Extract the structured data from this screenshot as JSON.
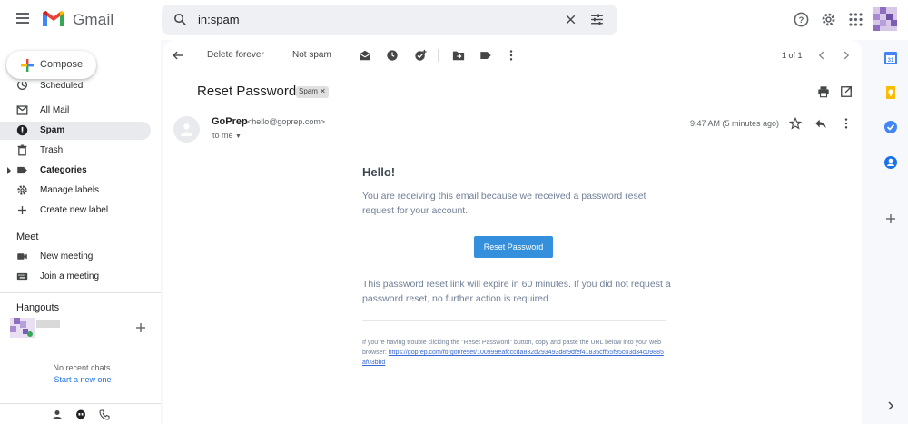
{
  "header": {
    "app_name": "Gmail",
    "search_value": "in:spam",
    "brand_colors": {
      "red": "#ea4335",
      "blue": "#4285f4",
      "green": "#34a853",
      "yellow": "#fbbc04"
    }
  },
  "nav": {
    "compose_label": "Compose",
    "items": [
      {
        "label": "Scheduled",
        "icon": "scheduled-icon"
      },
      {
        "label": "All Mail",
        "icon": "all-mail-icon"
      },
      {
        "label": "Spam",
        "icon": "spam-icon",
        "active": true
      },
      {
        "label": "Trash",
        "icon": "trash-icon"
      },
      {
        "label": "Categories",
        "icon": "label-icon"
      },
      {
        "label": "Manage labels",
        "icon": "gear-icon"
      },
      {
        "label": "Create new label",
        "icon": "plus-icon"
      }
    ],
    "meet": {
      "title": "Meet",
      "new_meeting": "New meeting",
      "join_meeting": "Join a meeting"
    },
    "hangouts": {
      "title": "Hangouts",
      "no_chats": "No recent chats",
      "start_new": "Start a new one"
    }
  },
  "toolbar": {
    "delete_forever": "Delete forever",
    "not_spam": "Not spam",
    "pager": "1 of 1"
  },
  "message": {
    "subject": "Reset Password",
    "badge": "Spam",
    "sender_name": "GoPrep",
    "sender_email": "<hello@goprep.com>",
    "to": "to me",
    "time": "9:47 AM (5 minutes ago)"
  },
  "email_body": {
    "greeting": "Hello!",
    "intro": "You are receiving this email because we received a password reset request for your account.",
    "button_label": "Reset Password",
    "expire_note": "This password reset link will expire in 60 minutes. If you did not request a password reset, no further action is required.",
    "trouble_text": "If you're having trouble clicking the \"Reset Password\" button, copy and paste the URL below into your web browser:",
    "reset_url": "https://goprep.com/forgot/reset/100999eafcccda832d293493d8f9dfef41835cff55f95c03d34c09885af03bbd",
    "accent_color": "#3490dc"
  }
}
